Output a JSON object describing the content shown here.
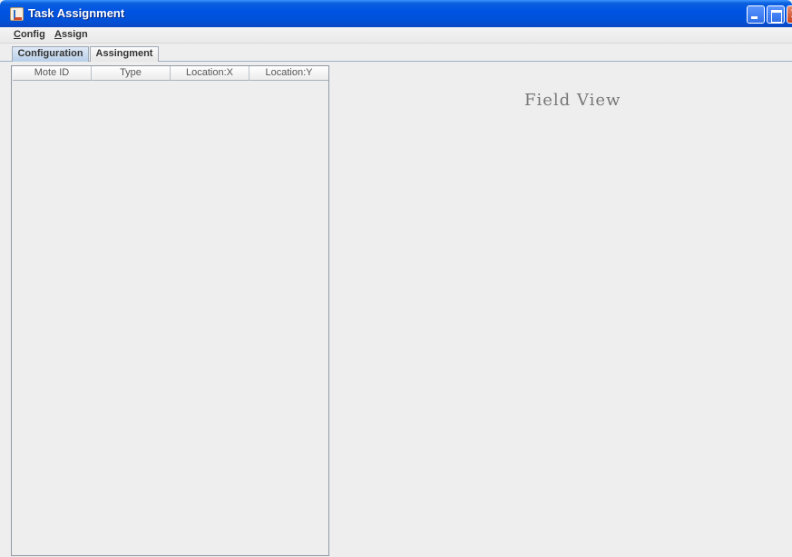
{
  "window": {
    "title": "Task Assignment"
  },
  "menubar": {
    "config": {
      "mnemonic": "C",
      "rest": "onfig"
    },
    "assign": {
      "mnemonic": "A",
      "rest": "ssign"
    }
  },
  "tabs": [
    {
      "label": "Configuration",
      "selected": true
    },
    {
      "label": "Assingment",
      "selected": false
    }
  ],
  "table": {
    "columns": [
      "Mote ID",
      "Type",
      "Location:X",
      "Location:Y"
    ],
    "rows": []
  },
  "field_view": {
    "title": "Field View"
  },
  "colors": {
    "titlebar": "#0054e3",
    "selected_tab": "#b7cfe9",
    "panel_bg": "#eeeeee",
    "field_view_text": "#777777"
  },
  "icons": {
    "app": "java-cup-icon",
    "minimize": "minimize-icon",
    "maximize": "maximize-icon",
    "close": "close-icon"
  }
}
